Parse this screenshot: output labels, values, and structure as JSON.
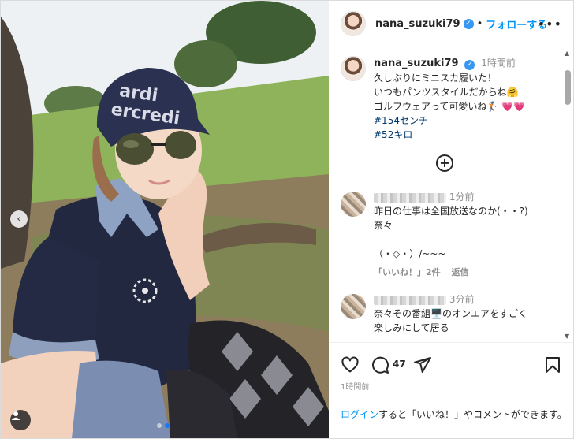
{
  "header": {
    "username": "nana_suzuki79",
    "separator": "•",
    "follow_label": "フォローする",
    "more_label": "•••"
  },
  "caption": {
    "username": "nana_suzuki79",
    "time": "1時間前",
    "lines": [
      "久しぶりにミニスカ履いた！",
      "いつもパンツスタイルだからね🤗",
      "ゴルフウェアって可愛いね🏌"
    ],
    "hearts": "💗💗",
    "hashtags": [
      "#154センチ",
      "#52キロ"
    ]
  },
  "comments": [
    {
      "time": "1分前",
      "lines": [
        "昨日の仕事は全国放送なのか(・・?)",
        "奈々",
        "",
        "（・◇・）/~~~"
      ],
      "likes_label": "「いいね！」2件",
      "reply_label": "返信"
    },
    {
      "time": "3分前",
      "lines": [
        "奈々その番組🖥️のオンエアをすごく",
        "楽しみにして居る"
      ]
    }
  ],
  "actions": {
    "like_icon": "heart-outline-icon",
    "comment_icon": "comment-bubble-icon",
    "comment_count": "47",
    "share_icon": "paper-plane-icon",
    "save_icon": "bookmark-icon",
    "post_time": "1時間前"
  },
  "login_prompt": {
    "link": "ログイン",
    "rest": "すると「いいね！」やコメントができます。"
  },
  "photo": {
    "cap_text": "Mardi Mercredi",
    "carousel_index": 2,
    "carousel_total": 2
  },
  "colors": {
    "accent": "#0095f6",
    "verified": "#3897f0",
    "heart": "#e1306c",
    "hashtag": "#00376b"
  }
}
